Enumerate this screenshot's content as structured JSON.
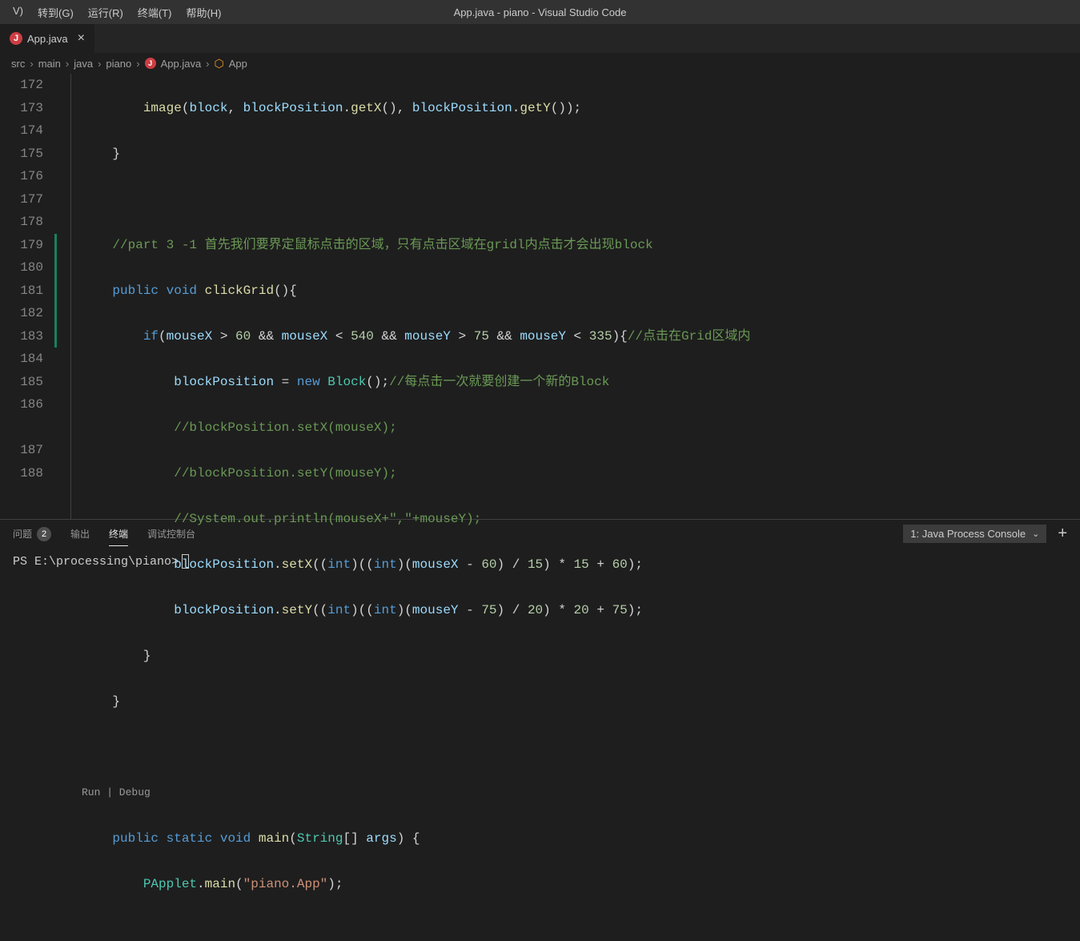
{
  "menubar": {
    "view": "V)",
    "goto": "转到(G)",
    "run": "运行(R)",
    "terminal": "终端(T)",
    "help": "帮助(H)"
  },
  "title": "App.java - piano - Visual Studio Code",
  "tab": {
    "label": "App.java",
    "iconLetter": "J"
  },
  "breadcrumb": {
    "parts": [
      "src",
      "main",
      "java",
      "piano"
    ],
    "file": "App.java",
    "symbol": "App",
    "iconLetter": "J"
  },
  "lineNumbers": [
    "172",
    "173",
    "174",
    "175",
    "176",
    "177",
    "178",
    "179",
    "180",
    "181",
    "182",
    "183",
    "184",
    "185",
    "186",
    "",
    "187",
    "188",
    ""
  ],
  "code": {
    "l172": {
      "fn": "image",
      "v1": "block",
      "v2": "blockPosition",
      "m1": "getX",
      "v3": "blockPosition",
      "m2": "getY"
    },
    "l173": "}",
    "l175": {
      "c": "//part 3 -1 首先我们要界定鼠标点击的区域，只有点击区域在gridl内点击才会出现block"
    },
    "l176": {
      "kw1": "public",
      "kw2": "void",
      "fn": "clickGrid"
    },
    "l177": {
      "kw": "if",
      "v1": "mouseX",
      "n1": "60",
      "v2": "mouseX",
      "n2": "540",
      "v3": "mouseY",
      "n3": "75",
      "v4": "mouseY",
      "n4": "335",
      "c": "//点击在Grid区域内"
    },
    "l178": {
      "v": "blockPosition",
      "kw": "new",
      "t": "Block",
      "c": "//每点击一次就要创建一个新的Block"
    },
    "l179": {
      "c": "//blockPosition.setX(mouseX);"
    },
    "l180": {
      "c": "//blockPosition.setY(mouseY);"
    },
    "l181": {
      "c": "//System.out.println(mouseX+\",\"+mouseY);"
    },
    "l182": {
      "v": "blockPosition",
      "fn": "setX",
      "t": "int",
      "v2": "mouseX",
      "n1": "60",
      "n2": "15",
      "n3": "15",
      "n4": "60"
    },
    "l183": {
      "v": "blockPosition",
      "fn": "setY",
      "t": "int",
      "v2": "mouseY",
      "n1": "75",
      "n2": "20",
      "n3": "20",
      "n4": "75"
    },
    "l184": "}",
    "l185": "}",
    "codelens": "Run | Debug",
    "l187": {
      "kw1": "public",
      "kw2": "static",
      "kw3": "void",
      "fn": "main",
      "t": "String",
      "v": "args"
    },
    "l188": {
      "t": "PApplet",
      "fn": "main",
      "s": "\"piano.App\""
    }
  },
  "panel": {
    "problems": "问题",
    "problemsCount": "2",
    "output": "输出",
    "terminal": "终端",
    "debugConsole": "调试控制台",
    "termSelect": "1: Java Process Console"
  },
  "terminal": {
    "prompt": "PS E:\\processing\\piano>"
  }
}
